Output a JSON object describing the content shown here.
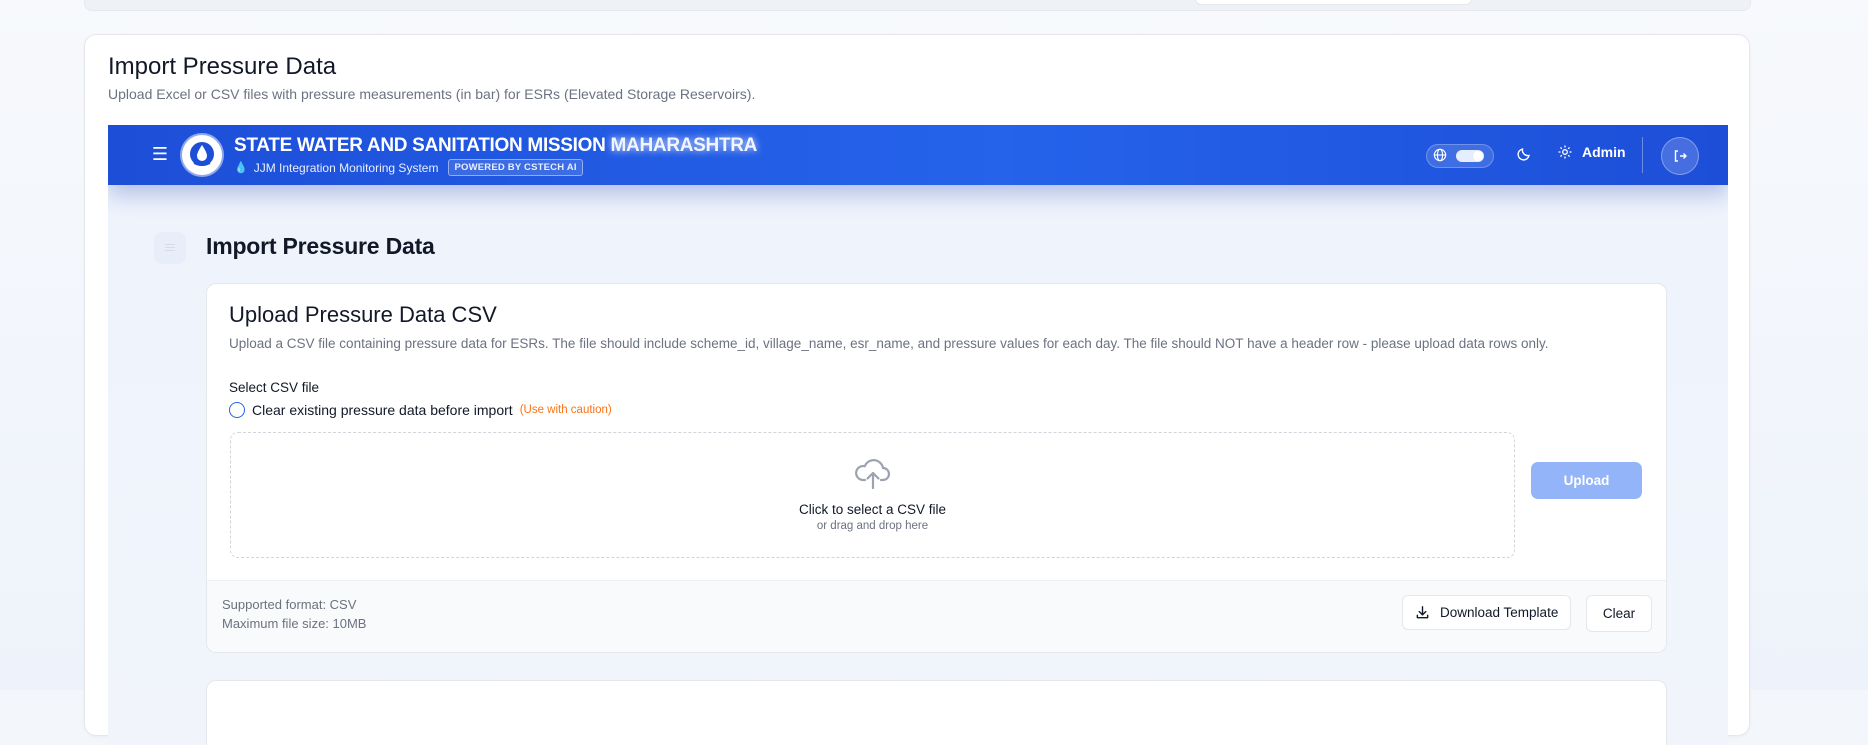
{
  "outer": {
    "title": "Import Pressure Data",
    "description": "Upload Excel or CSV files with pressure measurements (in bar) for ESRs (Elevated Storage Reservoirs)."
  },
  "header": {
    "title_main": "STATE WATER AND SANITATION MISSION ",
    "title_highlight": "MAHARASHTRA",
    "subtitle": "JJM Integration Monitoring System",
    "powered_by": "POWERED BY CSTECH AI",
    "user_label": "Admin",
    "icons": [
      "menu-icon",
      "globe-icon",
      "moon-icon",
      "gear-icon",
      "logout-icon"
    ],
    "accent_color": "#2563eb"
  },
  "page": {
    "title": "Import Pressure Data"
  },
  "upload_card": {
    "title": "Upload Pressure Data CSV",
    "description": "Upload a CSV file containing pressure data for ESRs. The file should include scheme_id, village_name, esr_name, and pressure values for each day. The file should NOT have a header row - please upload data rows only.",
    "select_label": "Select CSV file",
    "clear_option_label": "Clear existing pressure data before import",
    "clear_option_caution": "(Use with caution)",
    "dropzone_main": "Click to select a CSV file",
    "dropzone_sub": "or drag and drop here",
    "upload_button": "Upload",
    "footer": {
      "supported_format": "Supported format: CSV",
      "max_size": "Maximum file size: 10MB",
      "download_button": "Download Template",
      "clear_button": "Clear"
    }
  }
}
